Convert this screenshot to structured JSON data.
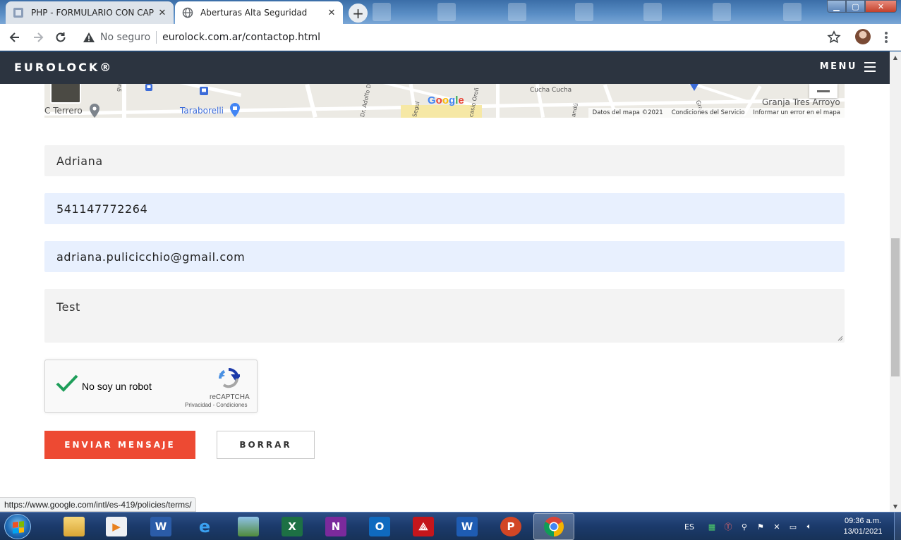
{
  "browser": {
    "tabs": [
      {
        "title": "PHP - FORMULARIO CON CAPTCHA",
        "active": false,
        "icon": "php-page-icon"
      },
      {
        "title": "Aberturas Alta Seguridad",
        "active": true,
        "icon": "globe-icon"
      }
    ],
    "security_label": "No seguro",
    "url": "eurolock.com.ar/contactop.html",
    "status_url": "https://www.google.com/intl/es-419/policies/terms/"
  },
  "site": {
    "brand": "EUROLOCK®",
    "menu_label": "MENU"
  },
  "map": {
    "labels": {
      "terrero": "C Terrero",
      "taraborelli": "Taraborelli",
      "granja": "Granja Tres Arroyo",
      "cucha": "Cucha Cucha",
      "angel": "guel Angel",
      "adolfo": "Dr. Adolfo D",
      "segui": "Seguí",
      "orono": "casio Oroñ",
      "grai": "Grai",
      "bandu": "andú"
    },
    "google": "Google",
    "attribution": [
      "Datos del mapa ©2021",
      "Condiciones del Servicio",
      "Informar un error en el mapa"
    ]
  },
  "form": {
    "name": "Adriana",
    "phone": "541147772264",
    "email": "adriana.pulicicchio@gmail.com",
    "message": "Test",
    "captcha_label": "No soy un robot",
    "captcha_brand": "reCAPTCHA",
    "captcha_terms": "Privacidad - Condiciones",
    "send_label": "ENVIAR MENSAJE",
    "clear_label": "BORRAR"
  },
  "taskbar": {
    "language": "ES",
    "time": "09:36 a.m.",
    "date": "13/01/2021"
  },
  "colors": {
    "site_header": "#2c3440",
    "send_button": "#ed4a33",
    "autofill_bg": "#e8f0fe",
    "checkmark": "#1e9e5a"
  }
}
